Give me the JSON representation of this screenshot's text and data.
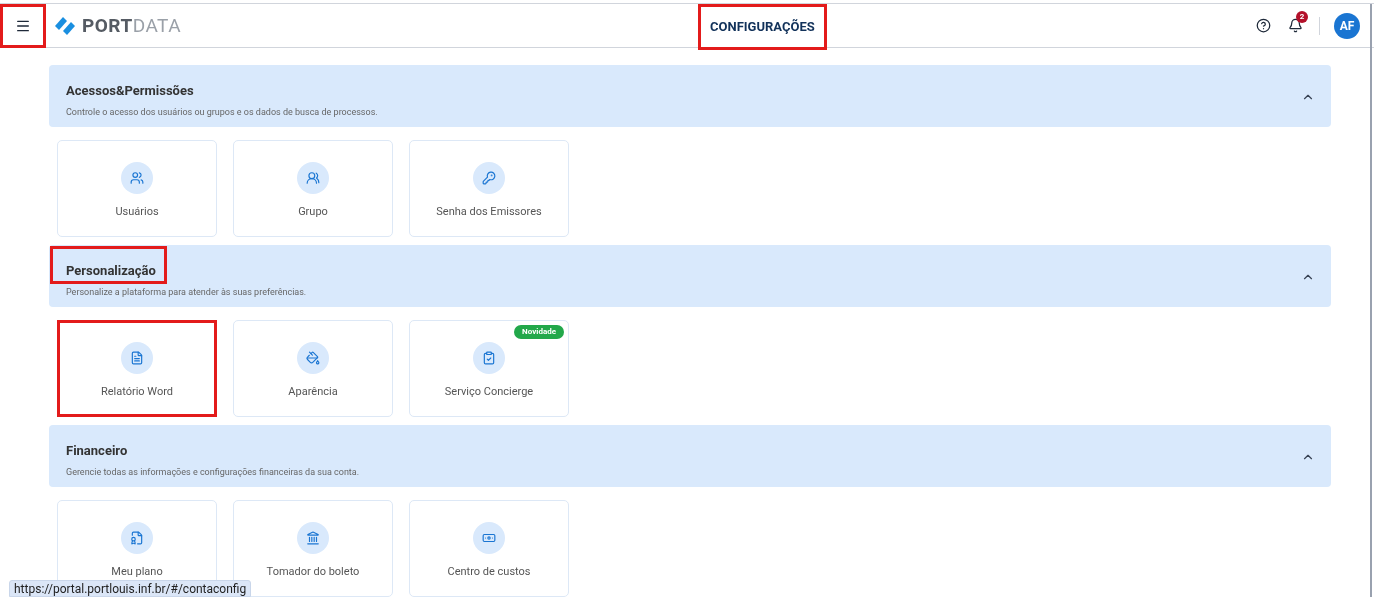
{
  "header": {
    "menu_highlighted": true,
    "logo": {
      "bold": "PORT",
      "light": "DATA"
    },
    "title": "CONFIGURAÇÕES",
    "title_highlighted": true,
    "notifications": "2",
    "avatar": "AF"
  },
  "sections": [
    {
      "title": "Acessos&Permissões",
      "title_highlighted": false,
      "description": "Controle o acesso dos usuários ou grupos e os dados de busca de processos.",
      "expanded": true,
      "cards": [
        {
          "label": "Usuários",
          "highlighted": false
        },
        {
          "label": "Grupo",
          "highlighted": false
        },
        {
          "label": "Senha dos Emissores",
          "highlighted": false
        }
      ]
    },
    {
      "title": "Personalização",
      "title_highlighted": true,
      "description": "Personalize a plataforma para atender às suas preferências.",
      "expanded": true,
      "cards": [
        {
          "label": "Relatório Word",
          "highlighted": true
        },
        {
          "label": "Aparência",
          "highlighted": false
        },
        {
          "label": "Serviço Concierge",
          "highlighted": false,
          "badge": "Novidade"
        }
      ]
    },
    {
      "title": "Financeiro",
      "title_highlighted": false,
      "description": "Gerencie todas as informações e configurações financeiras da sua conta.",
      "expanded": true,
      "cards": [
        {
          "label": "Meu plano",
          "highlighted": false
        },
        {
          "label": "Tomador do boleto",
          "highlighted": false
        },
        {
          "label": "Centro de custos",
          "highlighted": false
        }
      ]
    }
  ],
  "status_url": "https://portal.portlouis.inf.br/#/contaconfig"
}
